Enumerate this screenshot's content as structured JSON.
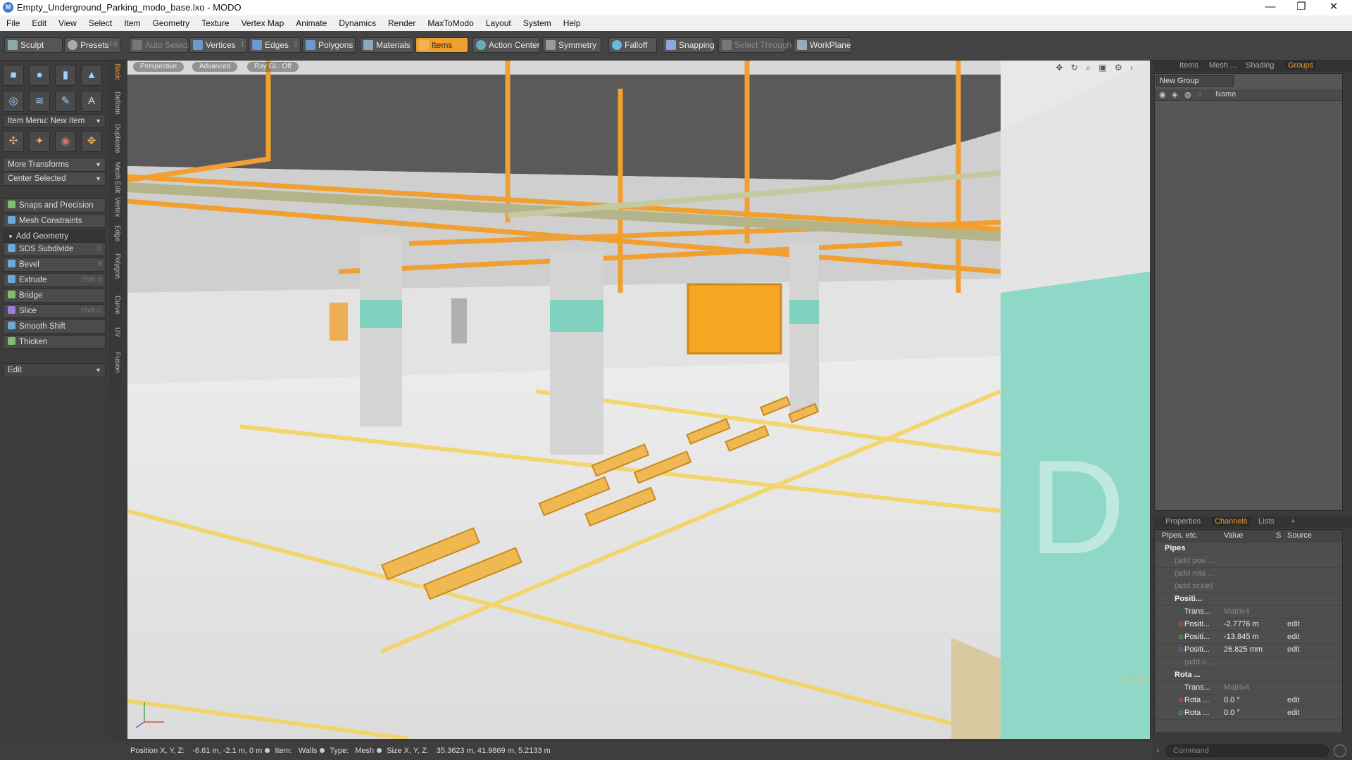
{
  "window": {
    "title": "Empty_Underground_Parking_modo_base.lxo - MODO",
    "controls": [
      "—",
      "❐",
      "✕"
    ]
  },
  "menu": [
    "File",
    "Edit",
    "View",
    "Select",
    "Item",
    "Geometry",
    "Texture",
    "Vertex Map",
    "Animate",
    "Dynamics",
    "Render",
    "MaxToModo",
    "Layout",
    "System",
    "Help"
  ],
  "toolbar": {
    "sculpt": "Sculpt",
    "presets": "Presets",
    "presets_key": "F6",
    "auto_select": "Auto Select",
    "vertices": "Vertices",
    "vertices_key": "1",
    "edges": "Edges",
    "edges_key": "2",
    "polygons": "Polygons",
    "materials": "Materials",
    "items": "Items",
    "action_center": "Action Center",
    "symmetry": "Symmetry",
    "falloff": "Falloff",
    "snapping": "Snapping",
    "select_through": "Select Through",
    "workplane": "WorkPlane"
  },
  "left": {
    "item_menu": "Item Menu: New Item",
    "more_transforms": "More Transforms",
    "center_selected": "Center Selected",
    "snaps": "Snaps and Precision",
    "mesh_constraints": "Mesh Constraints",
    "add_geometry": "Add Geometry",
    "tools": [
      {
        "label": "SDS Subdivide",
        "key": "D",
        "color": "#6aa9d8"
      },
      {
        "label": "Bevel",
        "key": "B",
        "color": "#6aa9d8"
      },
      {
        "label": "Extrude",
        "key": "Shift-X",
        "color": "#6aa9d8"
      },
      {
        "label": "Bridge",
        "key": "",
        "color": "#7fbf6a"
      },
      {
        "label": "Slice",
        "key": "Shift-C",
        "color": "#9c7fd8"
      },
      {
        "label": "Smooth Shift",
        "key": "",
        "color": "#6aa9d8"
      },
      {
        "label": "Thicken",
        "key": "",
        "color": "#7fbf6a"
      }
    ],
    "edit": "Edit",
    "vtabs": [
      "Basic",
      "Deform",
      "Duplicate",
      "Mesh Edit",
      "Vertex",
      "Edge",
      "Polygon",
      "Curve",
      "UV",
      "Fusion"
    ]
  },
  "viewport": {
    "view": "Perspective",
    "style": "Advanced",
    "raygl": "Ray GL: Off",
    "items_label": "1 Items"
  },
  "right": {
    "tabs_top": [
      "Items",
      "Mesh ...",
      "Shading",
      "Groups"
    ],
    "active_top": "Groups",
    "new_group": "New Group",
    "group_header": "Name",
    "tabs_bottom": [
      "Properties",
      "Channels",
      "Lists",
      "+"
    ],
    "active_bottom": "Channels",
    "ch_headers": [
      "Pipes, etc.",
      "Value",
      "S",
      "Source"
    ],
    "channels": [
      {
        "name": "Pipes",
        "value": "",
        "src": "",
        "indent": 1,
        "bold": true,
        "dot": ""
      },
      {
        "name": "(add posi ...",
        "value": "",
        "src": "",
        "indent": 2,
        "dim": true,
        "dot": ""
      },
      {
        "name": "(add rota ...",
        "value": "",
        "src": "",
        "indent": 2,
        "dim": true,
        "dot": ""
      },
      {
        "name": "(add scale)",
        "value": "",
        "src": "",
        "indent": 2,
        "dim": true,
        "dot": ""
      },
      {
        "name": "Positi...",
        "value": "",
        "src": "",
        "indent": 2,
        "bold": true,
        "dot": ""
      },
      {
        "name": "Trans...",
        "value": "Matrix4",
        "src": "",
        "indent": 3,
        "dimval": true,
        "dot": ""
      },
      {
        "name": "Positi...",
        "value": "-2.7776 m",
        "src": "edit",
        "indent": 3,
        "dot": "#e05050"
      },
      {
        "name": "Positi...",
        "value": "-13.845 m",
        "src": "edit",
        "indent": 3,
        "dot": "#50c050"
      },
      {
        "name": "Positi...",
        "value": "26.825 mm",
        "src": "edit",
        "indent": 3,
        "dot": "#5080e0"
      },
      {
        "name": "(add u ...",
        "value": "",
        "src": "",
        "indent": 3,
        "dim": true,
        "dot": ""
      },
      {
        "name": "Rota ...",
        "value": "",
        "src": "",
        "indent": 2,
        "bold": true,
        "dot": ""
      },
      {
        "name": "Trans...",
        "value": "Matrix4",
        "src": "",
        "indent": 3,
        "dimval": true,
        "dot": ""
      },
      {
        "name": "Rota ...",
        "value": "0.0 °",
        "src": "edit",
        "indent": 3,
        "dot": "#e05050"
      },
      {
        "name": "Rota ...",
        "value": "0.0 °",
        "src": "edit",
        "indent": 3,
        "dot": "#50c050"
      }
    ],
    "command_placeholder": "Command"
  },
  "status": {
    "pos_label": "Position X, Y, Z:",
    "pos_value": "-6.61 m, -2.1 m, 0 m",
    "item_label": "Item:",
    "item_value": "Walls",
    "type_label": "Type:",
    "type_value": "Mesh",
    "size_label": "Size X, Y, Z:",
    "size_value": "35.3623 m, 41.9869 m, 5.2133 m"
  },
  "colors": {
    "accent": "#f0a030",
    "teal": "#7fd1c0"
  }
}
